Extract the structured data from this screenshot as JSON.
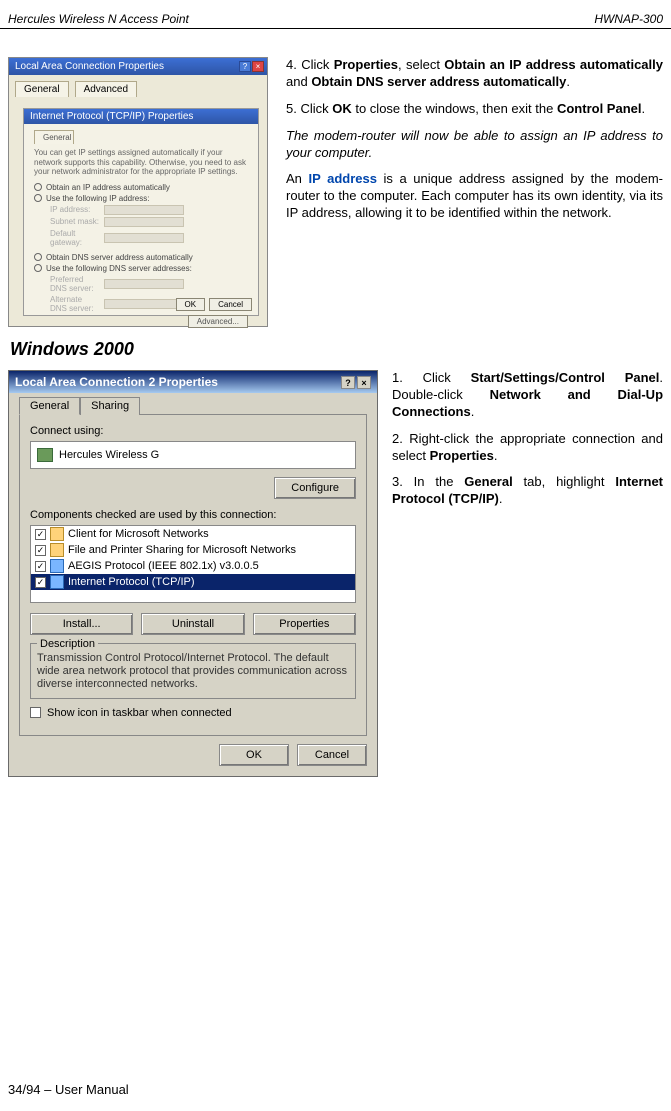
{
  "header": {
    "left": "Hercules Wireless N Access Point",
    "right": "HWNAP-300"
  },
  "fig1": {
    "outer_title": "Local Area Connection Properties",
    "tab1": "General",
    "tab2": "Advanced",
    "inner_title": "Internet Protocol (TCP/IP) Properties",
    "gen_tab": "General",
    "blurb": "You can get IP settings assigned automatically if your network supports this capability. Otherwise, you need to ask your network administrator for the appropriate IP settings.",
    "radio1": "Obtain an IP address automatically",
    "radio2": "Use the following IP address:",
    "radio3": "Obtain DNS server address automatically",
    "radio4": "Use the following DNS server addresses:",
    "advanced": "Advanced...",
    "ok": "OK",
    "cancel": "Cancel"
  },
  "steps1": {
    "s4": "4. Click ",
    "s4_b1": "Properties",
    "s4_m": ", select ",
    "s4_b2": "Obtain an IP address automatically",
    "s4_m2": " and ",
    "s4_b3": "Obtain DNS server address automatically",
    "s4_e": ".",
    "s5": "5. Click ",
    "s5_b1": "OK",
    "s5_m": " to close the windows, then exit the ",
    "s5_b2": "Control Panel",
    "s5_e": ".",
    "note": "The modem-router will now be able to assign an IP address to your computer.",
    "ip_pre": "An ",
    "ip_link": "IP address",
    "ip_post": " is a unique address assigned by the modem-router to the computer.  Each computer has its own identity, via its IP address, allowing it to be identified within the network."
  },
  "section": "Windows 2000",
  "fig2": {
    "title": "Local Area Connection 2 Properties",
    "tab_general": "General",
    "tab_sharing": "Sharing",
    "connect_using": "Connect using:",
    "nic": "Hercules Wireless G",
    "configure": "Configure",
    "components_label": "Components checked are used by this connection:",
    "comp1": "Client for Microsoft Networks",
    "comp2": "File and Printer Sharing for Microsoft Networks",
    "comp3": "AEGIS Protocol (IEEE 802.1x) v3.0.0.5",
    "comp4": "Internet Protocol (TCP/IP)",
    "install": "Install...",
    "uninstall": "Uninstall",
    "properties": "Properties",
    "description": "Description",
    "desc_text": "Transmission Control Protocol/Internet Protocol. The default wide area network protocol that provides communication across diverse interconnected networks.",
    "taskbar": "Show icon in taskbar when connected",
    "ok": "OK",
    "cancel": "Cancel"
  },
  "steps2": {
    "s1": "1. Click ",
    "s1_b1": "Start/Settings/Control Panel",
    "s1_m": ". Double-click ",
    "s1_b2": "Network and Dial-Up Connections",
    "s1_e": ".",
    "s2": "2. Right-click the appropriate connection and select ",
    "s2_b1": "Properties",
    "s2_e": ".",
    "s3": "3. In the ",
    "s3_b1": "General",
    "s3_m": " tab, highlight ",
    "s3_b2": "Internet Protocol (TCP/IP)",
    "s3_e": "."
  },
  "footer": "34/94 – User Manual"
}
